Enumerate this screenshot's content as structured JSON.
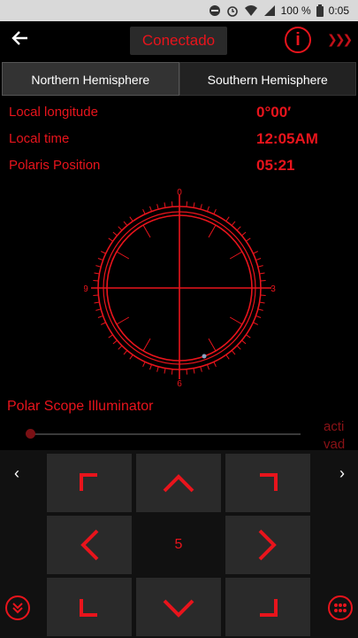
{
  "status": {
    "battery": "100 %",
    "time": "0:05"
  },
  "topbar": {
    "connection": "Conectado",
    "info_icon": "info-icon"
  },
  "tabs": [
    {
      "label": "Northern Hemisphere"
    },
    {
      "label": "Southern Hemisphere"
    }
  ],
  "fields": {
    "local_longitude": {
      "label": "Local longitude",
      "value": "0°00′"
    },
    "local_time": {
      "label": "Local time",
      "value": "12:05AM"
    },
    "polaris": {
      "label": "Polaris Position",
      "value": "05:21"
    }
  },
  "dial": {
    "top": "0",
    "right": "3",
    "bottom": "6",
    "left": "9"
  },
  "illuminator": {
    "label": "Polar Scope Illuminator",
    "level": 0,
    "status_line1": "acti",
    "status_line2": "vad"
  },
  "pad": {
    "center_value": "5"
  },
  "colors": {
    "accent": "#e8141c",
    "background": "#000000"
  }
}
